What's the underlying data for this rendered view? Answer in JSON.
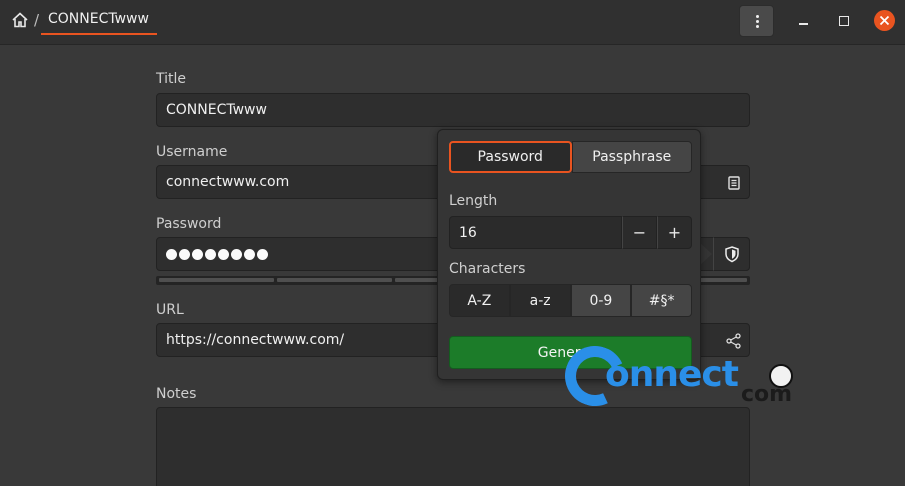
{
  "header": {
    "breadcrumb_sep": "/",
    "title": "CONNECTwww"
  },
  "form": {
    "title_label": "Title",
    "title_value": "CONNECTwww",
    "username_label": "Username",
    "username_value": "connectwww.com",
    "password_label": "Password",
    "password_masked_length": 8,
    "url_label": "URL",
    "url_value": "https://connectwww.com/",
    "notes_label": "Notes"
  },
  "generator": {
    "mode_password": "Password",
    "mode_passphrase": "Passphrase",
    "active_mode": "Password",
    "length_label": "Length",
    "length_value": "16",
    "decrement": "−",
    "increment": "+",
    "characters_label": "Characters",
    "char_sets": [
      "A-Z",
      "a-z",
      "0-9",
      "#§*"
    ],
    "generate_label": "Generate"
  },
  "watermark": {
    "text": "onnect",
    "suffix": "com"
  },
  "colors": {
    "accent": "#e95420",
    "generate": "#1c7c29",
    "watermark": "#2a8fe8"
  }
}
